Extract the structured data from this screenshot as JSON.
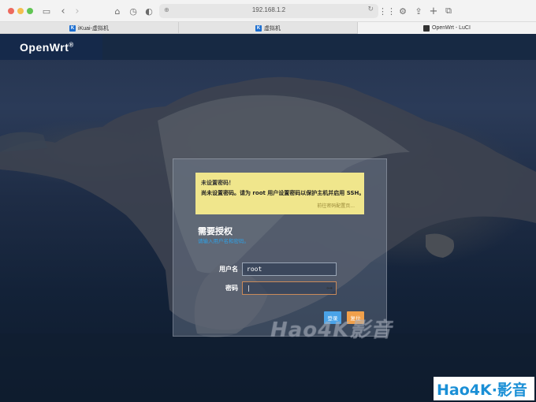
{
  "browser": {
    "url": "192.168.1.2",
    "tabs": [
      {
        "label": "iKuai-虚拟机",
        "icon": "ikuai-icon"
      },
      {
        "label": "虚拟机",
        "icon": "ikuai-icon"
      },
      {
        "label": "OpenWrt - LuCI",
        "icon": "openwrt-icon"
      }
    ]
  },
  "header": {
    "brand": "OpenWrt",
    "brand_mark": "®"
  },
  "alert": {
    "title": "未设置密码！",
    "message": "尚未设置密码。请为 root 用户设置密码以保护主机并启用 SSH。",
    "link": "前往密码配置页..."
  },
  "auth": {
    "title": "需要授权",
    "hint": "请输入用户名和密码。",
    "username_label": "用户名",
    "username_value": "root",
    "password_label": "密码",
    "password_value": "|",
    "login_label": "登录",
    "reset_label": "复位"
  },
  "watermark": {
    "center": "Hao4K影音",
    "corner": "Hao4K·影音"
  },
  "colors": {
    "header": "#162842",
    "alert": "#f0e68c",
    "login": "#4aa3e8",
    "reset": "#f0a04b",
    "hint": "#2ea0e6"
  }
}
